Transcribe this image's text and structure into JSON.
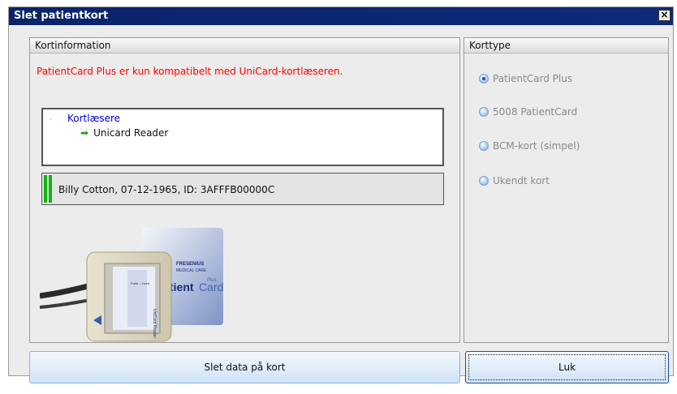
{
  "window": {
    "title": "Slet patientkort",
    "close_label": "×"
  },
  "card_info": {
    "header": "Kortinformation",
    "message": "PatientCard Plus er kun kompatibelt med UniCard-kortlæseren.",
    "readers_root": "Kortlæsere",
    "readers": [
      "Unicard Reader"
    ],
    "patient_line": "Billy Cotton, 07-12-1965, ID: 3AFFFB00000C"
  },
  "card_image": {
    "brand1": "FRESENIUS",
    "brand2": "MEDICAL CARE",
    "card_name_a": "tient",
    "card_name_b": "Card",
    "card_plus": "Plus",
    "reader_side": "UniCard Reader",
    "slot_text": "Patie... insert"
  },
  "card_type": {
    "header": "Korttype",
    "options": [
      {
        "label": "PatientCard Plus",
        "checked": true
      },
      {
        "label": "5008 PatientCard",
        "checked": false
      },
      {
        "label": "BCM-kort (simpel)",
        "checked": false
      },
      {
        "label": "Ukendt kort",
        "checked": false
      }
    ]
  },
  "buttons": {
    "delete": "Slet data på kort",
    "close": "Luk"
  },
  "colors": {
    "title_bar": "#0a246a",
    "error_text": "#ff0000",
    "link_text": "#0000dd",
    "status_green": "#12b312"
  }
}
